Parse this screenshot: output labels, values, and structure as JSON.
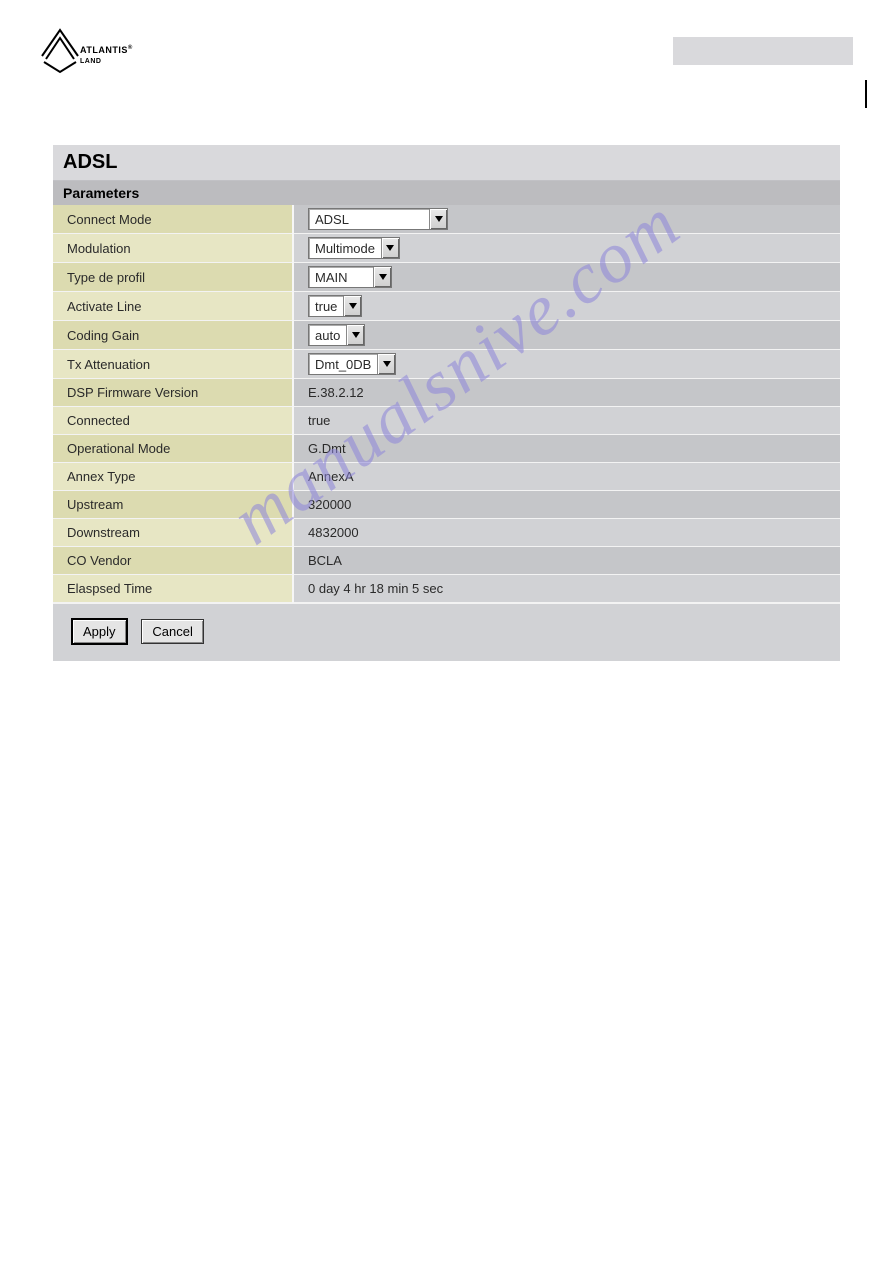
{
  "brand": "ATLANTIS",
  "brand_sub": "LAND",
  "watermark": "manualsnive.com",
  "panel": {
    "title": "ADSL",
    "subtitle": "Parameters"
  },
  "form": {
    "connect_mode": {
      "label": "Connect Mode",
      "value": "ADSL"
    },
    "modulation": {
      "label": "Modulation",
      "value": "Multimode"
    },
    "profile_type": {
      "label": "Type de profil",
      "value": "MAIN"
    },
    "activate_line": {
      "label": "Activate Line",
      "value": "true"
    },
    "coding_gain": {
      "label": "Coding Gain",
      "value": "auto"
    },
    "tx_attenuation": {
      "label": "Tx Attenuation",
      "value": "Dmt_0DB"
    },
    "dsp_firmware": {
      "label": "DSP Firmware Version",
      "value": "E.38.2.12"
    },
    "connected": {
      "label": "Connected",
      "value": "true"
    },
    "operational_mode": {
      "label": "Operational Mode",
      "value": "G.Dmt"
    },
    "annex_type": {
      "label": "Annex Type",
      "value": "AnnexA"
    },
    "upstream": {
      "label": "Upstream",
      "value": "320000"
    },
    "downstream": {
      "label": "Downstream",
      "value": "4832000"
    },
    "co_vendor": {
      "label": "CO Vendor",
      "value": "BCLA"
    },
    "elapsed_time": {
      "label": "Elaspsed Time",
      "value": "0 day 4 hr 18 min 5 sec"
    }
  },
  "buttons": {
    "apply": "Apply",
    "cancel": "Cancel"
  }
}
